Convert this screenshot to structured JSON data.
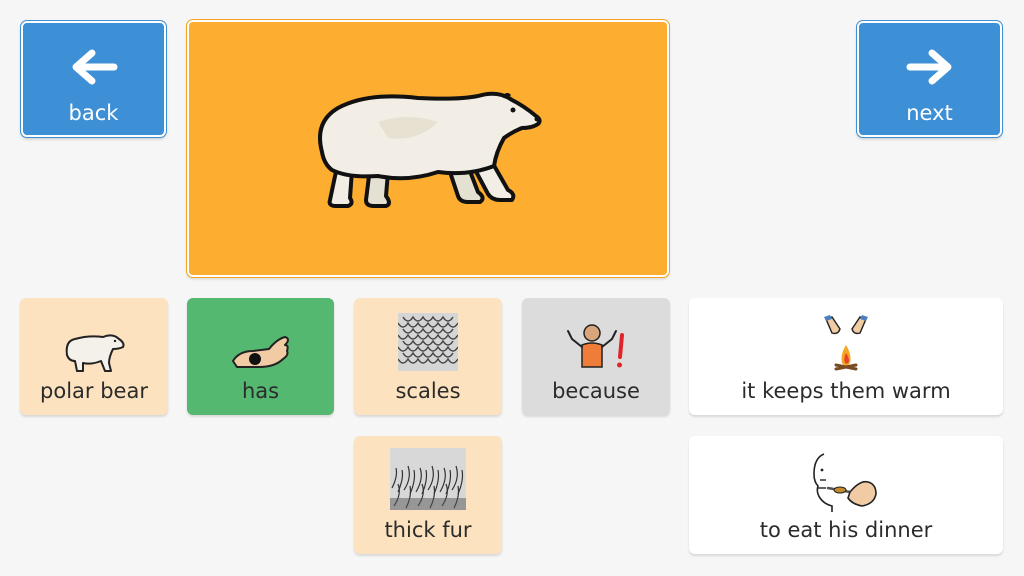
{
  "nav": {
    "back_label": "back",
    "next_label": "next",
    "color": "#3d8fd6"
  },
  "hero": {
    "icon": "polar-bear-icon",
    "color": "#fdad2f"
  },
  "sentence": [
    {
      "label": "polar bear",
      "icon": "polar-bear-icon",
      "color": "#fde2bf"
    },
    {
      "label": "has",
      "icon": "hand-holding-icon",
      "color": "#55b870"
    },
    {
      "label": "scales",
      "icon": "scales-pattern-icon",
      "color": "#fde2bf"
    },
    {
      "label": "because",
      "icon": "shrug-person-icon",
      "color": "#dcdcdc"
    },
    {
      "label": "it keeps them warm",
      "icon": "hands-warming-fire-icon",
      "color": "#ffffff"
    }
  ],
  "options": [
    {
      "label": "thick fur",
      "icon": "fur-texture-icon",
      "color": "#fde2bf"
    },
    {
      "label": "to eat his dinner",
      "icon": "eating-with-spoon-icon",
      "color": "#ffffff"
    }
  ]
}
